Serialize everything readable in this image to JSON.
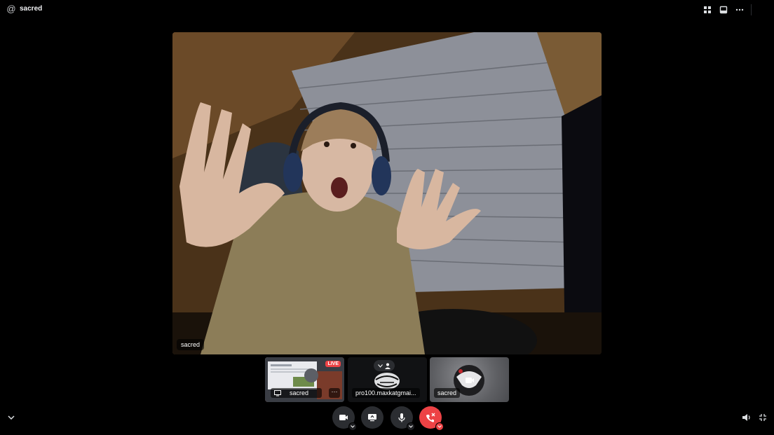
{
  "header": {
    "channel_icon": "at-icon",
    "channel_name": "sacred",
    "actions": [
      {
        "name": "grid-layout-icon"
      },
      {
        "name": "inbox-icon"
      },
      {
        "name": "more-icon"
      }
    ]
  },
  "main_stream": {
    "participant": "sacred"
  },
  "tiles": [
    {
      "label": "sacred",
      "icon": "screen-share-icon",
      "badge": "LIVE",
      "has_more": true
    },
    {
      "label": "pro100.maxkatgmai...",
      "icon": "user-icon"
    },
    {
      "label": "sacred",
      "icon": "video-off-icon"
    }
  ],
  "controls": [
    {
      "name": "camera-icon",
      "has_dropdown": true
    },
    {
      "name": "screen-share-icon",
      "has_dropdown": false
    },
    {
      "name": "microphone-icon",
      "has_dropdown": true
    },
    {
      "name": "disconnect-icon",
      "has_dropdown": true
    }
  ],
  "colors": {
    "background": "#000000",
    "control": "#2b2d31",
    "danger": "#ed4245"
  }
}
